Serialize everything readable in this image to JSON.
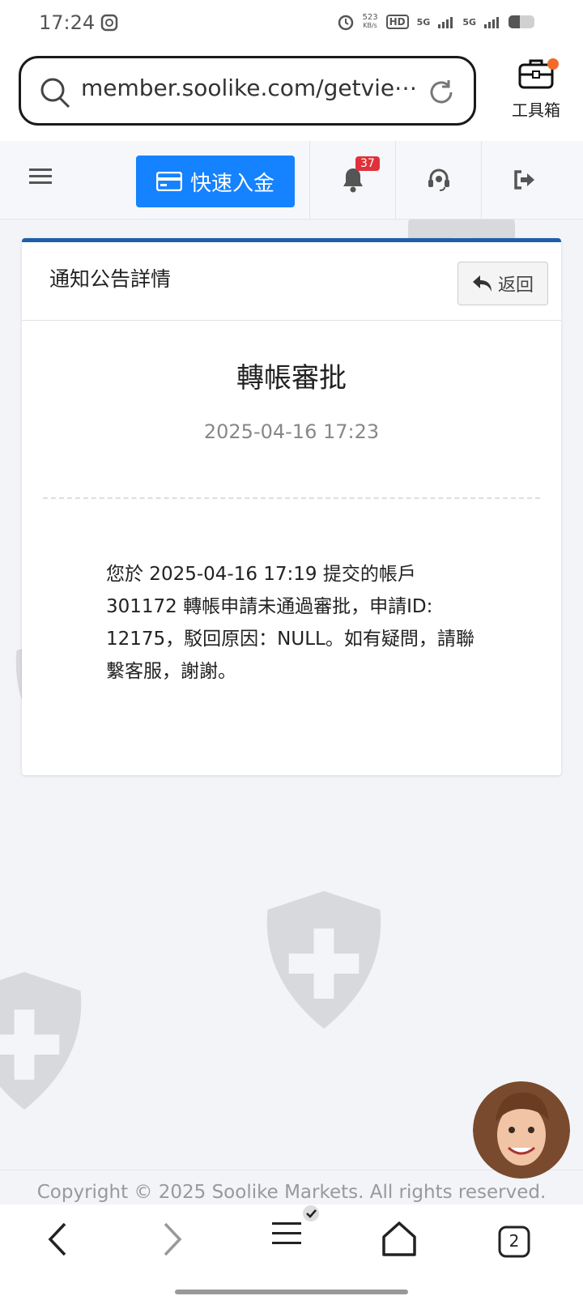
{
  "status_bar": {
    "time": "17:24",
    "net_speed_value": "523",
    "net_speed_unit": "KB/s",
    "hd_label": "HD",
    "signal_1": "5G",
    "signal_2": "5G",
    "battery_level": 0.45
  },
  "browser": {
    "url": "member.soolike.com/getvie⋯",
    "toolbox_label": "工具箱"
  },
  "header": {
    "deposit_label": "快速入金",
    "notification_count": "37"
  },
  "card": {
    "title": "通知公告詳情",
    "back_label": "返回",
    "notice_title": "轉帳審批",
    "notice_date": "2025-04-16 17:23",
    "notice_body": "您於 2025-04-16 17:19 提交的帳戶 301172 轉帳申請未通過審批，申請ID: 12175，駁回原因：NULL。如有疑問，請聯繫客服，謝謝。"
  },
  "footer": {
    "copyright": "Copyright © 2025 Soolike Markets. All rights reserved."
  },
  "bottom_nav": {
    "tabs_count": "2"
  },
  "colors": {
    "accent_blue": "#1582ff",
    "card_top_border": "#1f5fa8",
    "badge_red": "#e0313b",
    "toolbox_dot": "#f26b2a"
  }
}
